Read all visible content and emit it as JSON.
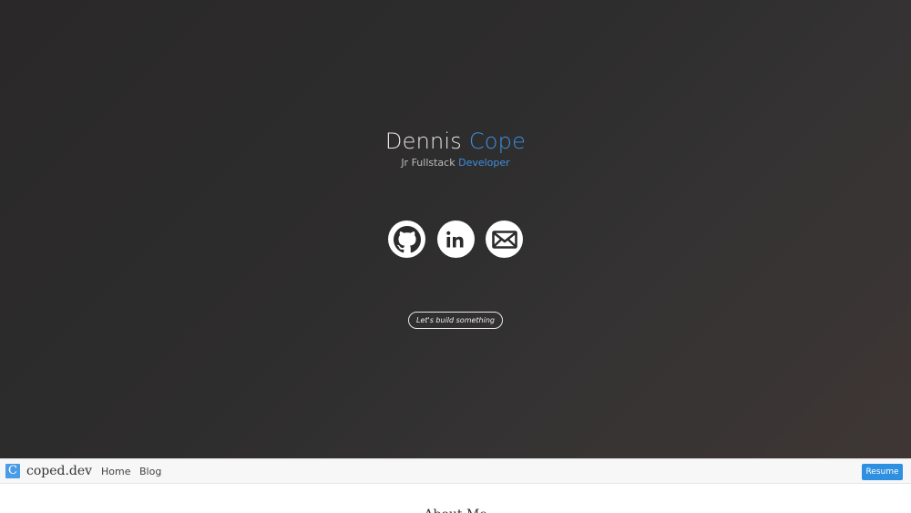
{
  "hero": {
    "name_first": "Dennis",
    "name_last": "Cope",
    "role_prefix": "Jr Fullstack",
    "role_accent": "Developer",
    "social": [
      {
        "icon": "github-icon"
      },
      {
        "icon": "linkedin-icon"
      },
      {
        "icon": "mail-icon"
      }
    ],
    "cta_label": "Let's build something",
    "accent_color": "#3d8fe0"
  },
  "navbar": {
    "logo_letter": "C",
    "brand": "coped.dev",
    "links": [
      "Home",
      "Blog"
    ],
    "resume_label": "Resume",
    "resume_color": "#2f8fe0"
  },
  "section": {
    "heading_peek": "About Me"
  }
}
